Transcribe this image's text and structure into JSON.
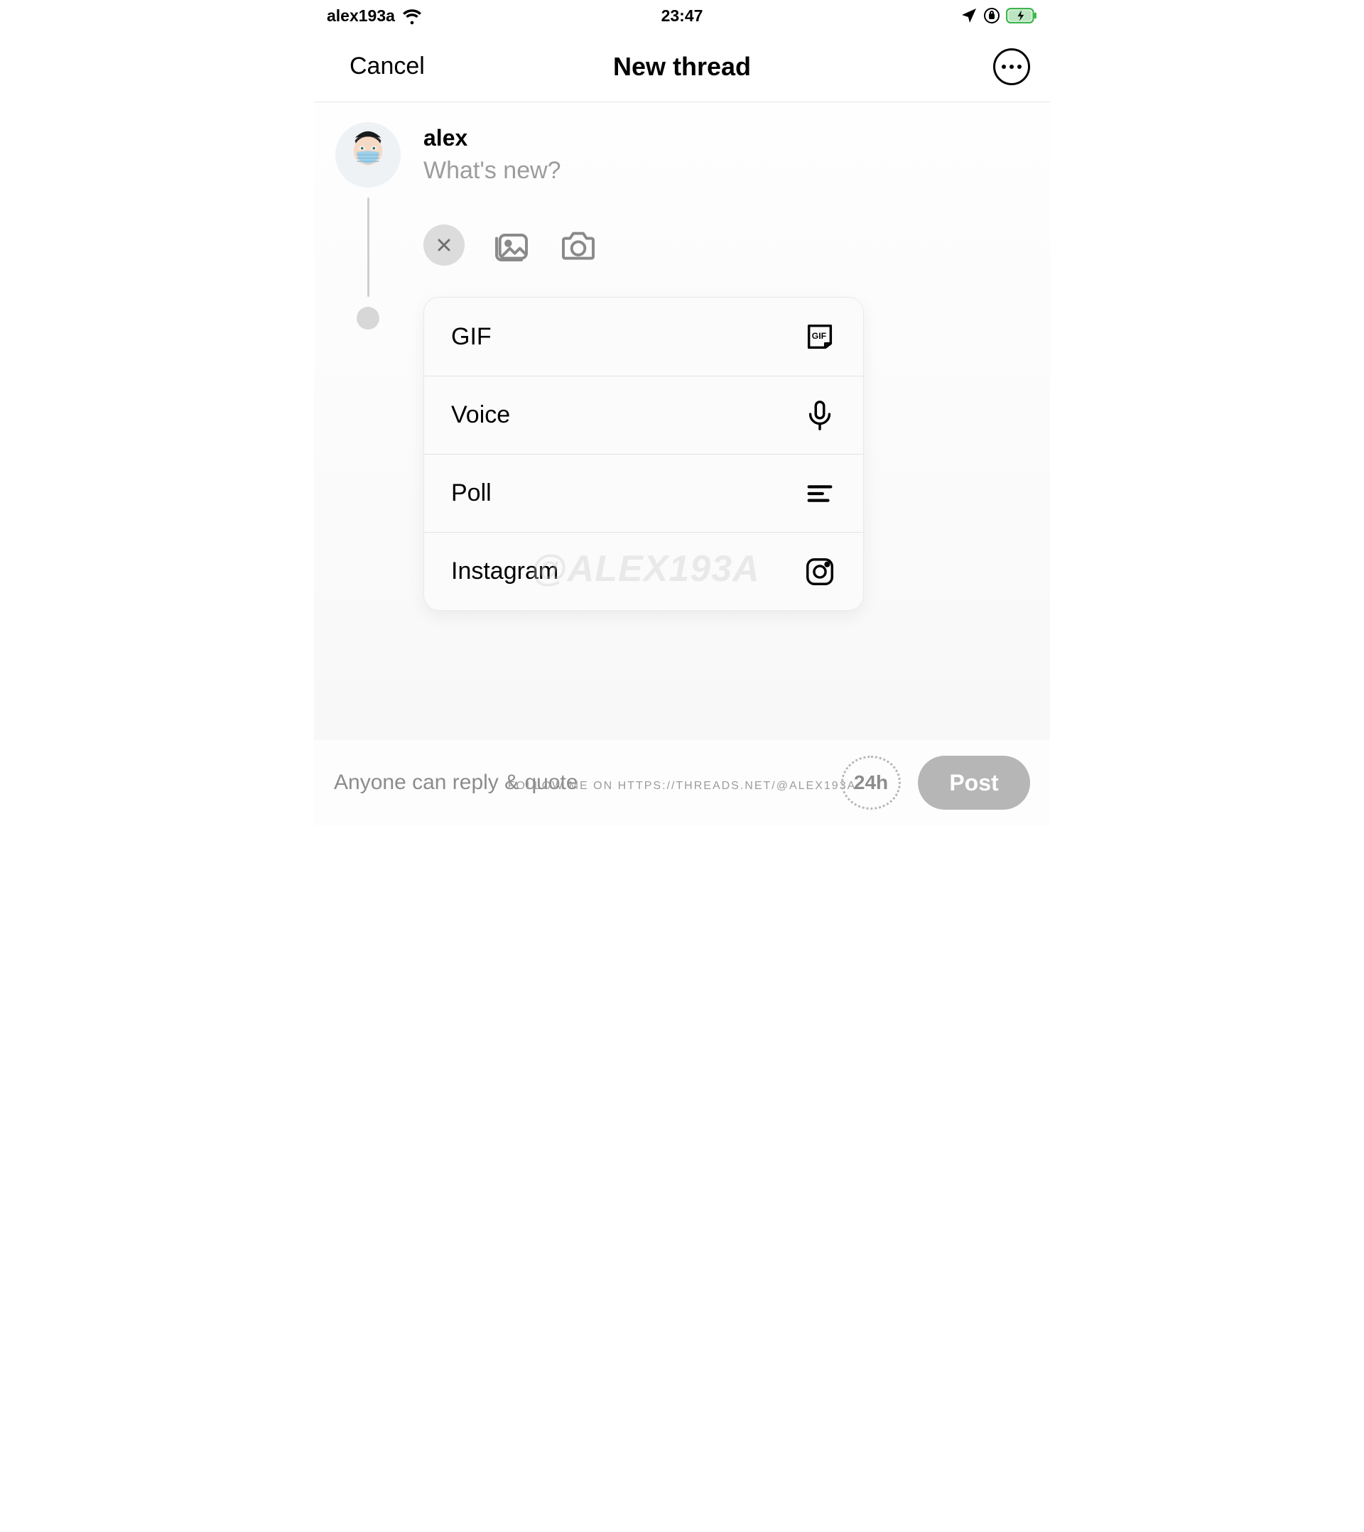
{
  "status_bar": {
    "carrier": "alex193a",
    "time": "23:47"
  },
  "header": {
    "cancel_label": "Cancel",
    "title": "New thread"
  },
  "compose": {
    "username": "alex",
    "placeholder": "What's new?",
    "menu_items": [
      {
        "label": "GIF"
      },
      {
        "label": "Voice"
      },
      {
        "label": "Poll"
      },
      {
        "label": "Instagram"
      }
    ],
    "watermark": "@ALEX193A",
    "follow_line": "FOLLOW ME ON HTTPS://THREADS.NET/@ALEX193A"
  },
  "footer": {
    "reply_setting": "Anyone can reply & quote",
    "timer_label": "24h",
    "post_label": "Post"
  }
}
